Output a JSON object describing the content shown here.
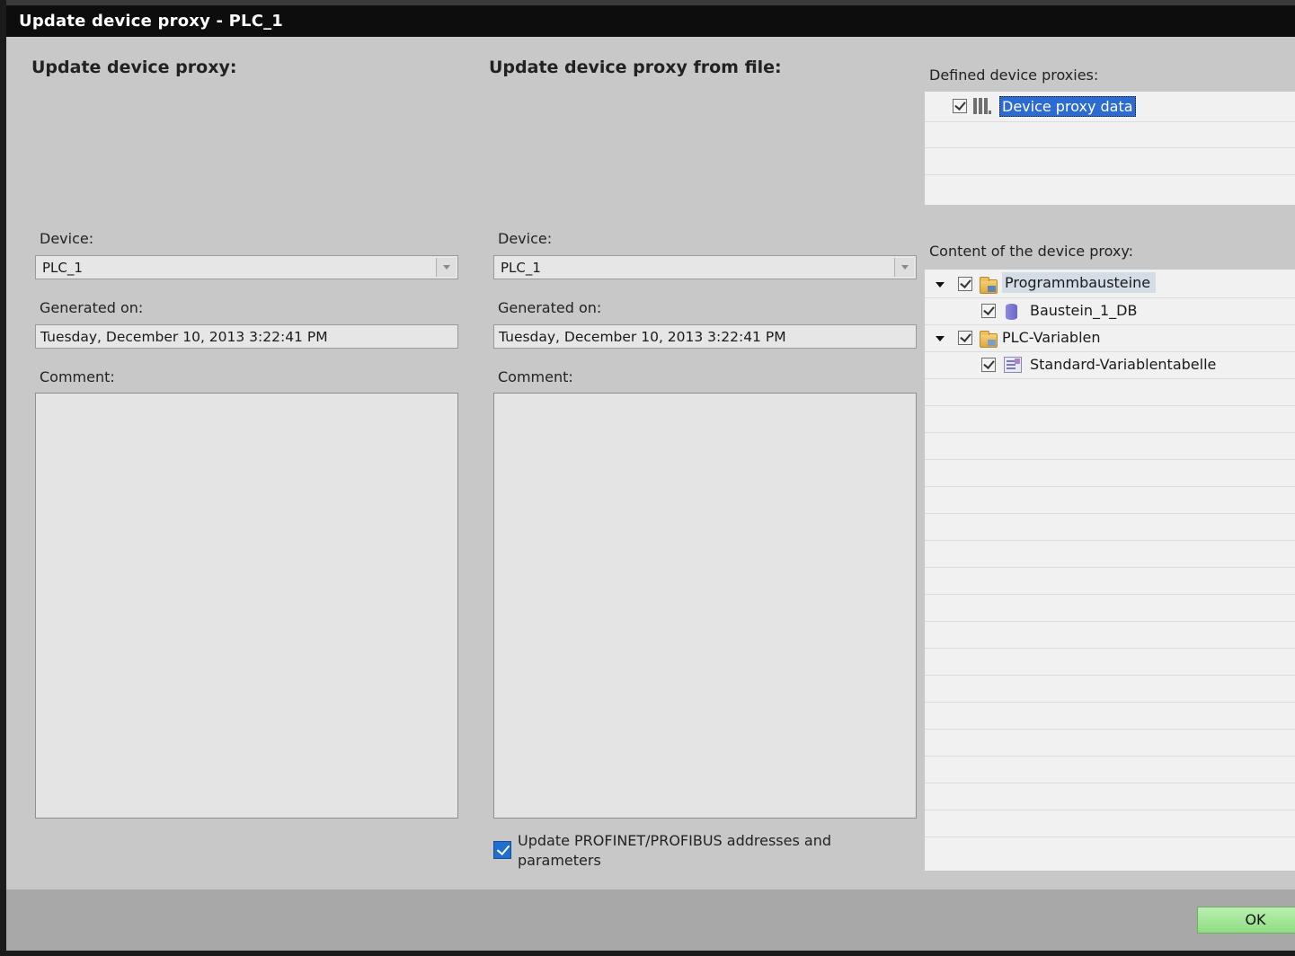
{
  "window": {
    "title": "Update device proxy - PLC_1"
  },
  "left": {
    "heading": "Update device proxy:",
    "device_label": "Device:",
    "device_value": "PLC_1",
    "generated_label": "Generated on:",
    "generated_value": "Tuesday, December 10, 2013 3:22:41 PM",
    "comment_label": "Comment:",
    "comment_value": ""
  },
  "middle": {
    "heading": "Update device proxy from file:",
    "device_label": "Device:",
    "device_value": "PLC_1",
    "generated_label": "Generated on:",
    "generated_value": "Tuesday, December 10, 2013 3:22:41 PM",
    "comment_label": "Comment:",
    "comment_value": "",
    "update_addresses_label_line1": "Update PROFINET/PROFIBUS addresses and",
    "update_addresses_label_line2": "parameters",
    "update_addresses_checked": true
  },
  "right": {
    "defined_heading": "Defined device proxies:",
    "defined_items": [
      {
        "label": "Device proxy data",
        "checked": true,
        "icon": "device-proxy-icon",
        "selected": true
      }
    ],
    "content_heading": "Content of the device proxy:",
    "content_items": [
      {
        "label": "Programmbausteine",
        "checked": true,
        "icon": "program-blocks-folder-icon",
        "expanded": true,
        "level": 0
      },
      {
        "label": "Baustein_1_DB",
        "checked": true,
        "icon": "data-block-icon",
        "level": 1
      },
      {
        "label": "PLC-Variablen",
        "checked": true,
        "icon": "plc-tags-folder-icon",
        "expanded": true,
        "level": 0
      },
      {
        "label": "Standard-Variablentabelle",
        "checked": true,
        "icon": "tag-table-icon",
        "level": 1
      }
    ]
  },
  "footer": {
    "ok_label": "OK"
  },
  "colors": {
    "title_bar": "#0d0d0d",
    "dialog_bg": "#c8c8c8",
    "selection": "#2c6bd0",
    "ok_button": "#9fe393",
    "checkbox_blue": "#1e6fd0"
  }
}
